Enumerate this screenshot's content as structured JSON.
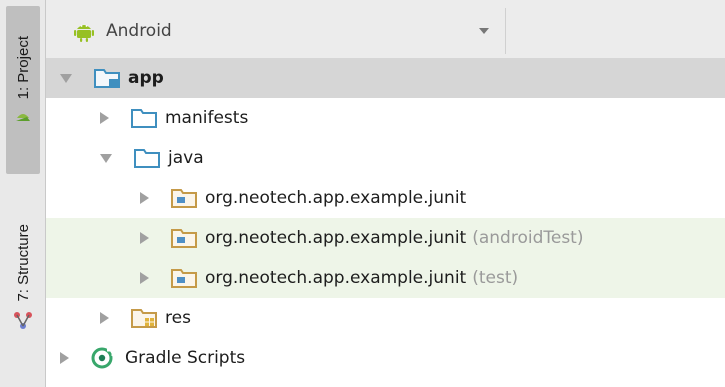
{
  "toolstrip": {
    "project_tab": "1: Project",
    "structure_tab": "7: Structure"
  },
  "header": {
    "view_mode": "Android"
  },
  "tree": {
    "app": "app",
    "manifests": "manifests",
    "java": "java",
    "pkg1": "org.neotech.app.example.junit",
    "pkg2": "org.neotech.app.example.junit",
    "pkg2_suffix": "(androidTest)",
    "pkg3": "org.neotech.app.example.junit",
    "pkg3_suffix": "(test)",
    "res": "res",
    "gradle": "Gradle Scripts"
  },
  "colors": {
    "folder_blue": "#3f8fbf",
    "android_green": "#97c024",
    "selection": "#d6d6d6",
    "test_highlight": "#eef5e8"
  }
}
